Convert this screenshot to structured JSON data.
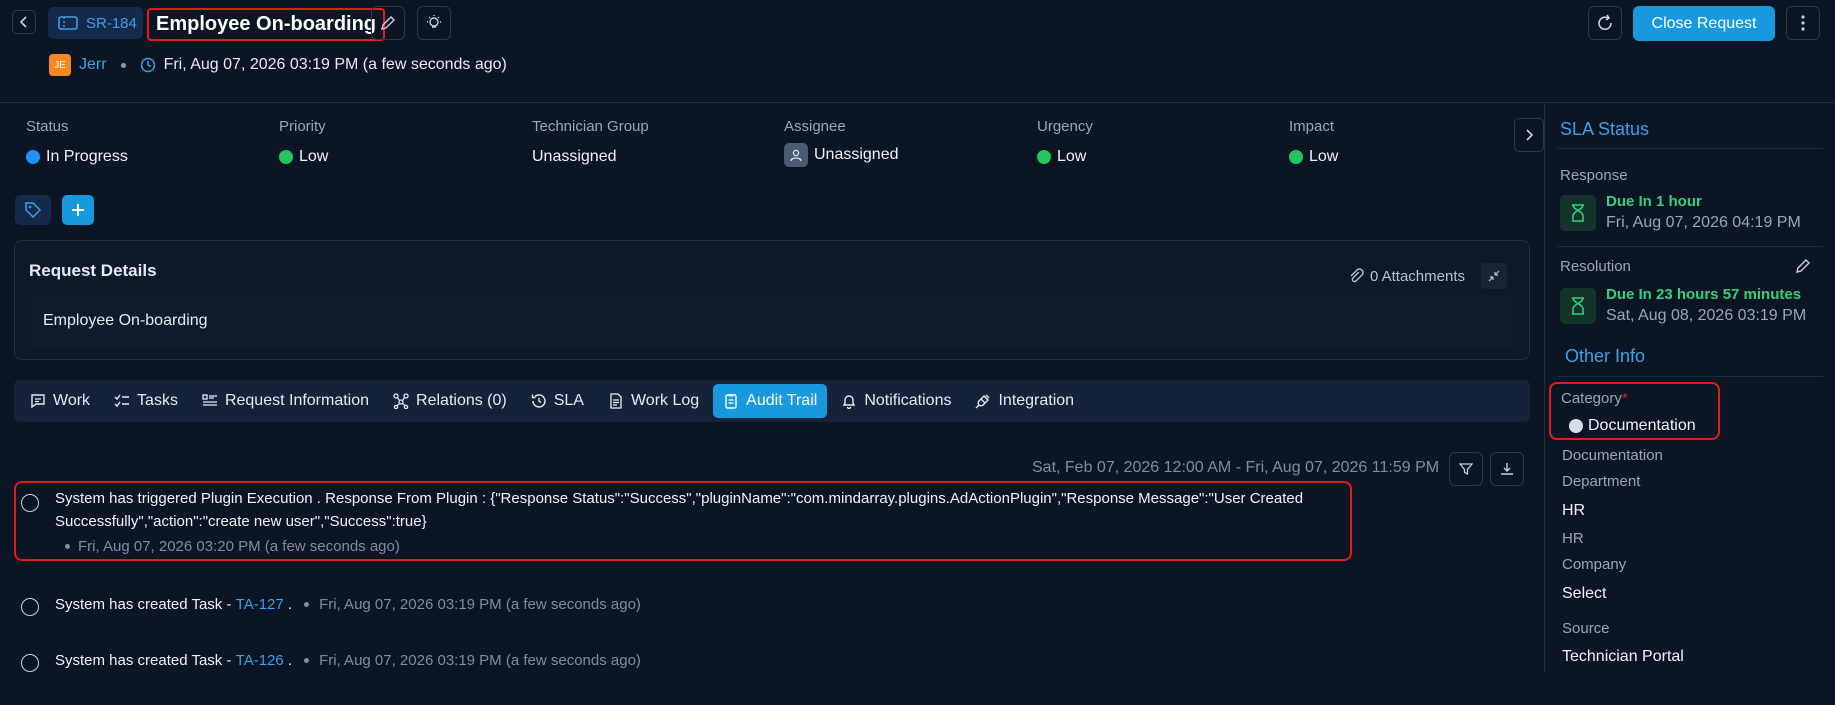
{
  "header": {
    "request_id": "SR-184",
    "title": "Employee On-boarding",
    "requester_initials": "JE",
    "requester": "Jerr",
    "created_at": "Fri, Aug 07, 2026 03:19 PM (a few seconds ago)",
    "close_label": "Close Request"
  },
  "fields": [
    {
      "label": "Status",
      "value": "In Progress",
      "color": "#1e90ff"
    },
    {
      "label": "Priority",
      "value": "Low",
      "color": "#22c55e"
    },
    {
      "label": "Technician Group",
      "value": "Unassigned"
    },
    {
      "label": "Assignee",
      "value": "Unassigned"
    },
    {
      "label": "Urgency",
      "value": "Low",
      "color": "#22c55e"
    },
    {
      "label": "Impact",
      "value": "Low",
      "color": "#22c55e"
    }
  ],
  "details": {
    "title": "Request Details",
    "attachments": "0 Attachments",
    "body": "Employee On-boarding"
  },
  "tabs": [
    {
      "label": "Work",
      "icon": "chat-icon"
    },
    {
      "label": "Tasks",
      "icon": "checklist-icon"
    },
    {
      "label": "Request Information",
      "icon": "list-icon"
    },
    {
      "label": "Relations (0)",
      "icon": "relations-icon"
    },
    {
      "label": "SLA",
      "icon": "history-icon"
    },
    {
      "label": "Work Log",
      "icon": "document-icon"
    },
    {
      "label": "Audit Trail",
      "icon": "clipboard-icon",
      "active": true
    },
    {
      "label": "Notifications",
      "icon": "bell-icon"
    },
    {
      "label": "Integration",
      "icon": "plug-icon"
    }
  ],
  "audit": {
    "range": "Sat, Feb 07, 2026 12:00 AM - Fri, Aug 07, 2026 11:59 PM",
    "entries": [
      {
        "line1": "System has triggered Plugin Execution . Response From Plugin : {\"Response Status\":\"Success\",\"pluginName\":\"com.mindarray.plugins.AdActionPlugin\",\"Response Message\":\"User Created",
        "line2": "Successfully\",\"action\":\"create new user\",\"Success\":true}",
        "time": "Fri, Aug 07, 2026 03:20 PM (a few seconds ago)"
      },
      {
        "prefix": "System has created Task - ",
        "task": "TA-127",
        "suffix": " .",
        "time": "Fri, Aug 07, 2026 03:19 PM (a few seconds ago)"
      },
      {
        "prefix": "System has created Task - ",
        "task": "TA-126",
        "suffix": " .",
        "time": "Fri, Aug 07, 2026 03:19 PM (a few seconds ago)"
      }
    ]
  },
  "sla": {
    "title": "SLA Status",
    "response_label": "Response",
    "response_due": "Due In 1 hour",
    "response_date": "Fri, Aug 07, 2026 04:19 PM",
    "resolution_label": "Resolution",
    "resolution_due": "Due In 23 hours 57 minutes",
    "resolution_date": "Sat, Aug 08, 2026 03:19 PM"
  },
  "other_info": {
    "title": "Other Info",
    "category_label": "Category",
    "category_required": "*",
    "category_value": "Documentation",
    "category_sub": "Documentation",
    "department_label": "Department",
    "department_value": "HR",
    "department_sub": "HR",
    "company_label": "Company",
    "company_value": "Select",
    "source_label": "Source",
    "source_value": "Technician Portal"
  }
}
